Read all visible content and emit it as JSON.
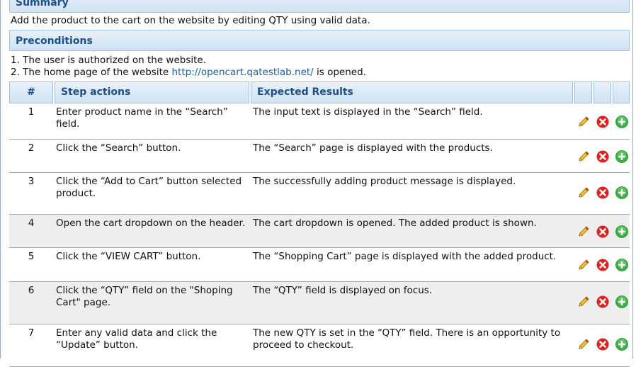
{
  "summary": {
    "title": "Summary",
    "text": "Add the product to the cart on the website by editing QTY using valid data."
  },
  "preconditions": {
    "title": "Preconditions",
    "line1": "1. The user is authorized on the website.",
    "line2_prefix": "2. The home page of the website",
    "line2_link": "http://opencart.qatestlab.net/",
    "line2_suffix": "is opened."
  },
  "table": {
    "headers": {
      "num": "#",
      "actions": "Step actions",
      "results": "Expected Results"
    },
    "rows": [
      {
        "num": "1",
        "action": "Enter product name in the “Search” field.",
        "result": "The input text is displayed in the “Search” field."
      },
      {
        "num": "2",
        "action": "Click the “Search” button.",
        "result": "The “Search” page is displayed with the  products."
      },
      {
        "num": "3",
        "action": "Click the “Add to Cart” button selected product.",
        "result": "The successfully adding product message is displayed."
      },
      {
        "num": "4",
        "action": "Open the cart dropdown on the header.",
        "result": "The cart dropdown is opened. The added product is shown."
      },
      {
        "num": "5",
        "action": "Click the “VIEW CART” button.",
        "result": "The “Shopping Cart” page is displayed with the added product."
      },
      {
        "num": "6",
        "action": "Click the “QTY” field on the \"Shoping Cart\" page.",
        "result": "The “QTY” field is displayed on focus."
      },
      {
        "num": "7",
        "action": "Enter any valid data and click the “Update” button.",
        "result": "The new QTY is set in the “QTY” field. There is an opportunity to proceed to checkout."
      }
    ]
  },
  "icons": {
    "edit": "pencil-icon",
    "delete": "delete-icon",
    "add": "add-icon"
  },
  "colors": {
    "header_text": "#1a4f8a",
    "link": "#1a5fa8",
    "delete": "#e02020",
    "add": "#3cb043",
    "row_alt": "#eeeeee"
  }
}
